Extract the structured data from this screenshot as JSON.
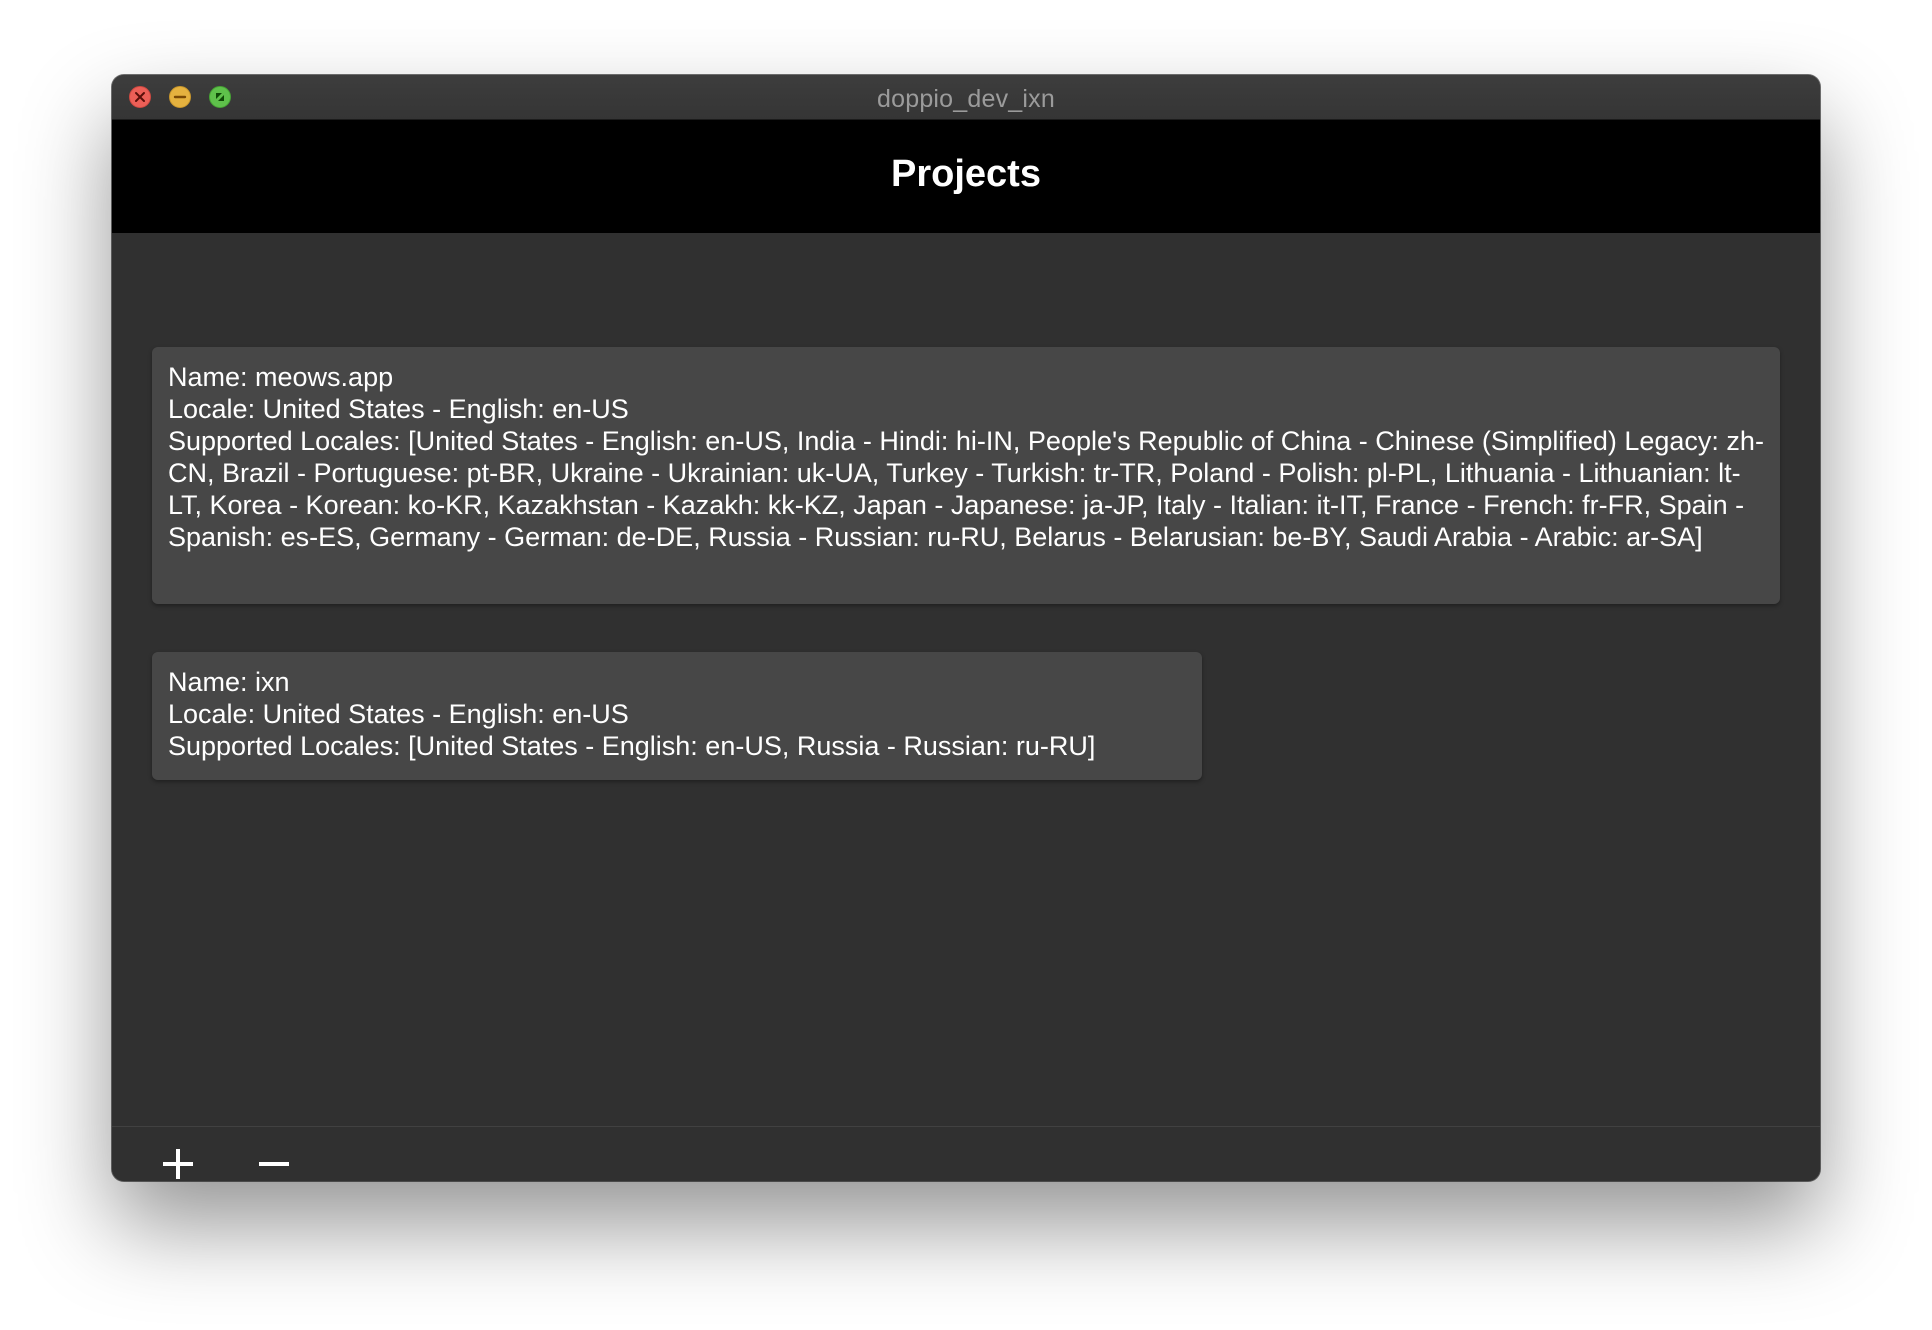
{
  "window": {
    "title": "doppio_dev_ixn",
    "controls": [
      "close-icon",
      "minimize-icon",
      "zoom-icon"
    ]
  },
  "header": {
    "title": "Projects"
  },
  "projects": [
    {
      "name_line": "Name: meows.app",
      "locale_line": "Locale: United States - English: en-US",
      "supported_line": "Supported Locales: [United States - English: en-US, India - Hindi: hi-IN, People's Republic of China - Chinese (Simplified) Legacy: zh-CN, Brazil - Portuguese: pt-BR, Ukraine - Ukrainian: uk-UA, Turkey - Turkish: tr-TR, Poland - Polish: pl-PL, Lithuania - Lithuanian: lt-LT, Korea - Korean: ko-KR, Kazakhstan - Kazakh: kk-KZ, Japan - Japanese: ja-JP, Italy - Italian: it-IT, France - French: fr-FR, Spain - Spanish: es-ES, Germany - German: de-DE, Russia - Russian: ru-RU, Belarus - Belarusian: be-BY, Saudi Arabia - Arabic: ar-SA]"
    },
    {
      "name_line": "Name: ixn",
      "locale_line": "Locale: United States - English: en-US",
      "supported_line": "Supported Locales: [United States - English: en-US, Russia - Russian: ru-RU]"
    }
  ],
  "toolbar": {
    "add_icon": "plus-icon",
    "remove_icon": "minus-icon"
  },
  "colors": {
    "close": "#ec5f57",
    "minimize": "#e5b23f",
    "zoom": "#5fc14b",
    "header_bg": "#000000",
    "content_bg": "#303030",
    "card_bg": "#474747"
  }
}
